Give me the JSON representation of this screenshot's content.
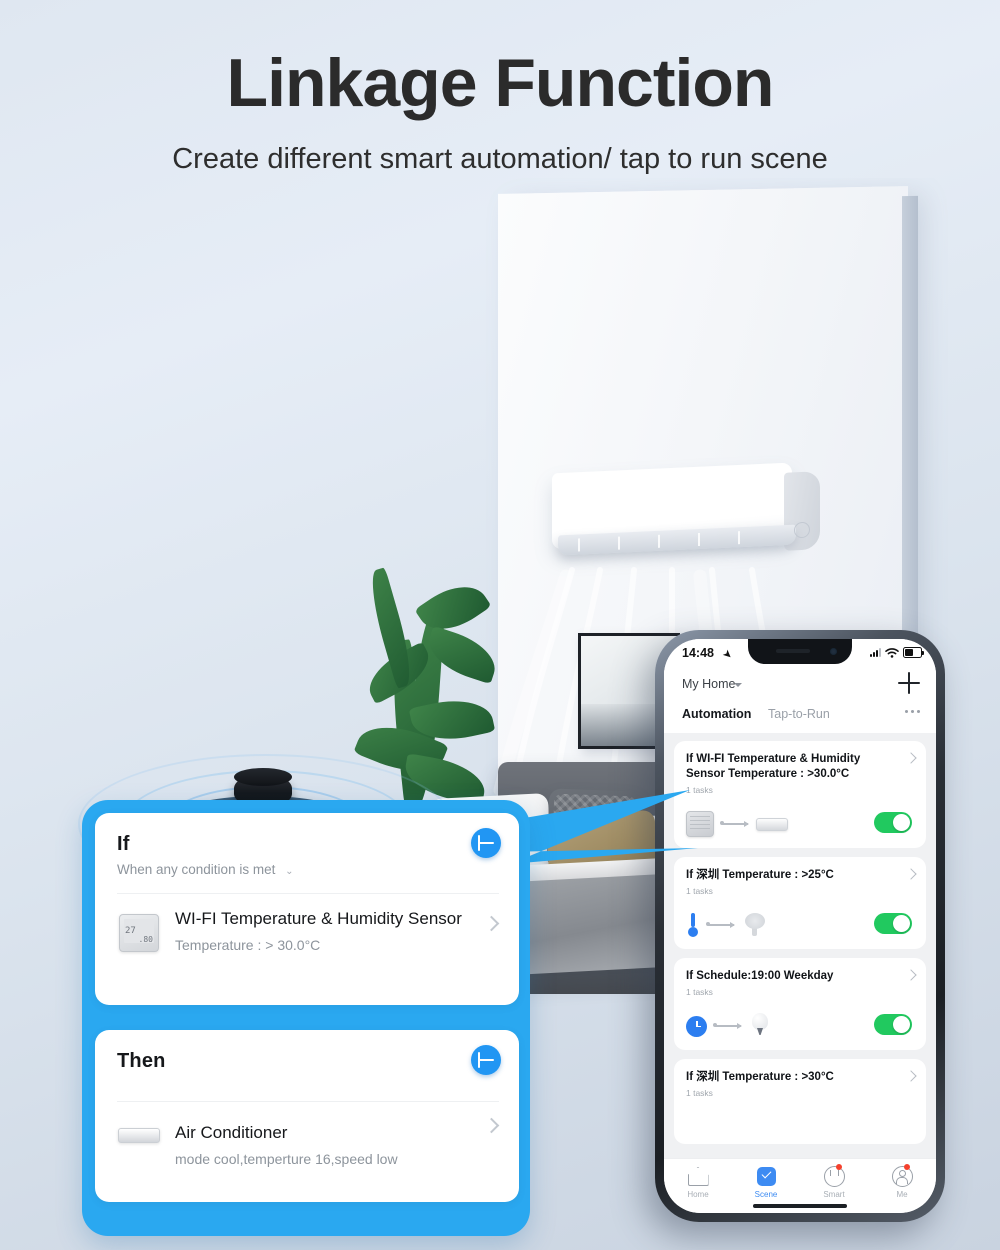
{
  "header": {
    "title": "Linkage Function",
    "subtitle": "Create different smart automation/ tap to run scene"
  },
  "phone": {
    "status_bar": {
      "time": "14:48",
      "location_icon": "location-arrow-icon",
      "signal_icon": "cellular-signal-icon",
      "wifi_icon": "wifi-icon",
      "battery_icon": "battery-icon"
    },
    "home_selector": {
      "label": "My Home",
      "caret_icon": "chevron-down-icon",
      "add_icon": "plus-icon"
    },
    "tabs": [
      {
        "label": "Automation",
        "active": true
      },
      {
        "label": "Tap-to-Run",
        "active": false
      }
    ],
    "more_icon": "ellipsis-icon",
    "automations": [
      {
        "title": "If WI-FI Temperature & Humidity Sensor Temperature : >30.0°C",
        "tasks": "1 tasks",
        "trigger_icon": "temperature-humidity-sensor-icon",
        "action_icon": "air-conditioner-icon",
        "toggle_on": true
      },
      {
        "title": "If 深圳 Temperature : >25°C",
        "tasks": "1 tasks",
        "trigger_icon": "thermometer-icon",
        "action_icon": "fan-icon",
        "toggle_on": true
      },
      {
        "title": "If Schedule:19:00 Weekday",
        "tasks": "1 tasks",
        "trigger_icon": "clock-icon",
        "action_icon": "light-bulb-icon",
        "toggle_on": true
      },
      {
        "title": "If 深圳 Temperature : >30°C",
        "tasks": "1 tasks",
        "trigger_icon": "",
        "action_icon": "",
        "toggle_on": false
      }
    ],
    "tabbar": [
      {
        "label": "Home",
        "icon": "home-icon",
        "active": false,
        "badge": false
      },
      {
        "label": "Scene",
        "icon": "scene-check-icon",
        "active": true,
        "badge": false
      },
      {
        "label": "Smart",
        "icon": "smart-icon",
        "active": false,
        "badge": true
      },
      {
        "label": "Me",
        "icon": "profile-icon",
        "active": false,
        "badge": true
      }
    ]
  },
  "editor": {
    "if_card": {
      "title": "If",
      "condition_mode": "When any condition is met",
      "caret_icon": "chevron-down-icon",
      "add_icon": "plus-icon",
      "item": {
        "name": "WI-FI Temperature & Humidity Sensor",
        "desc": "Temperature : > 30.0°C",
        "icon": "temperature-humidity-sensor-icon",
        "chevron_icon": "chevron-right-icon",
        "display_value_1": "27",
        "display_value_2": ".80"
      }
    },
    "then_card": {
      "title": "Then",
      "add_icon": "plus-icon",
      "item": {
        "name": "Air Conditioner",
        "desc": "mode cool,temperture 16,speed low",
        "icon": "air-conditioner-icon",
        "chevron_icon": "chevron-right-icon"
      }
    }
  },
  "scene": {
    "air_conditioner": "wall-mounted-air-conditioner",
    "hub": "smart-ir-hub",
    "plant": "potted-plant",
    "bed": "bed",
    "wall_art": "framed-wall-art"
  },
  "colors": {
    "accent_blue": "#2aa8f0",
    "button_blue": "#2196f3",
    "toggle_green": "#21c95f",
    "tab_active": "#3d8bf2",
    "badge_red": "#f5402c",
    "title_dark": "#2b2b2b"
  }
}
